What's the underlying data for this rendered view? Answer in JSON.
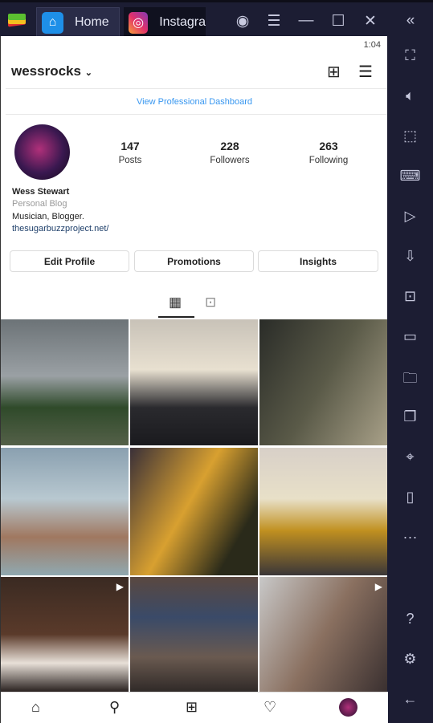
{
  "emulator": {
    "tabs": [
      {
        "label": "Home",
        "icon": "home-icon"
      },
      {
        "label": "Instagra",
        "icon": "instagram-icon"
      }
    ],
    "controls": [
      "account-icon",
      "menu-icon",
      "minimize-icon",
      "maximize-icon",
      "close-icon",
      "collapse-icon"
    ],
    "sidebar": [
      "fullscreen-icon",
      "volume-icon",
      "select-icon",
      "keyboard-icon",
      "screen-record-icon",
      "apk-icon",
      "screenshot-icon",
      "camera-icon",
      "folder-icon",
      "multi-instance-icon",
      "location-icon",
      "shake-icon",
      "more-icon",
      "help-icon",
      "settings-icon",
      "back-icon"
    ],
    "bg_color": "#1c1d33"
  },
  "status": {
    "time": "1:04"
  },
  "profile": {
    "username": "wessrocks",
    "dashboard_link": "View Professional Dashboard",
    "stats": [
      {
        "value": "147",
        "label": "Posts"
      },
      {
        "value": "228",
        "label": "Followers"
      },
      {
        "value": "263",
        "label": "Following"
      }
    ],
    "name": "Wess Stewart",
    "category": "Personal Blog",
    "bio": "Musician, Blogger.",
    "website": "thesugarbuzzproject.net/",
    "buttons": [
      "Edit Profile",
      "Promotions",
      "Insights"
    ],
    "accent": "#3897f0"
  },
  "grid": [
    {
      "desc": "storm-sky",
      "video": false
    },
    {
      "desc": "ammo-boxes",
      "video": false
    },
    {
      "desc": "masked-selfie",
      "video": false
    },
    {
      "desc": "child-beach",
      "video": false
    },
    {
      "desc": "drinks",
      "video": false
    },
    {
      "desc": "ammo-boxes-2",
      "video": false
    },
    {
      "desc": "synthesizer",
      "video": true
    },
    {
      "desc": "studio",
      "video": false
    },
    {
      "desc": "car-selfie",
      "video": true
    }
  ],
  "nav": [
    "home-icon",
    "search-icon",
    "new-post-icon",
    "heart-icon",
    "profile-avatar"
  ]
}
